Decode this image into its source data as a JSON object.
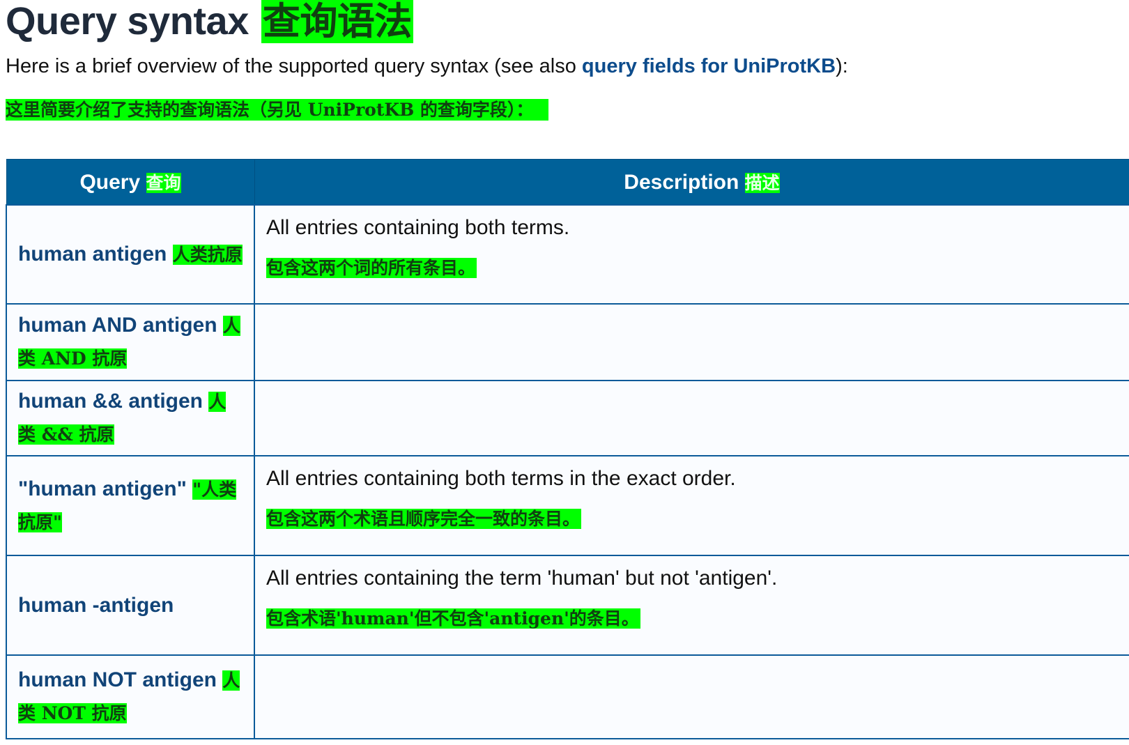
{
  "page": {
    "title_en": "Query syntax",
    "title_zh": "查询语法",
    "intro_before": "Here is a brief overview of the supported query syntax (see also ",
    "intro_link": "query fields for UniProtKB",
    "intro_after": "):",
    "intro_zh": "这里简要介绍了支持的查询语法（另见 UniProtKB 的查询字段）："
  },
  "table": {
    "headers": [
      {
        "en": "Query",
        "zh": "查询"
      },
      {
        "en": "Description",
        "zh": "描述"
      }
    ],
    "rows": [
      {
        "query": "human antigen",
        "query_zh": "人类抗原",
        "desc": "All entries containing both terms.",
        "desc_zh": "包含这两个词的所有条目。"
      },
      {
        "query": "human AND antigen",
        "query_zh": "人类 AND 抗原",
        "desc": "",
        "desc_zh": ""
      },
      {
        "query": "human && antigen",
        "query_zh": "人类 && 抗原",
        "desc": "",
        "desc_zh": ""
      },
      {
        "query": "\"human antigen\"",
        "query_zh": "\"人类抗原\"",
        "desc": "All entries containing both terms in the exact order.",
        "desc_zh": "包含这两个术语且顺序完全一致的条目。"
      },
      {
        "query": "human -antigen",
        "query_zh": "",
        "desc": "All entries containing the term 'human' but not 'antigen'.",
        "desc_zh": "包含术语'human'但不包含'antigen'的条目。"
      },
      {
        "query": "human NOT antigen",
        "query_zh": "人类 NOT 抗原",
        "desc": "",
        "desc_zh": ""
      }
    ]
  },
  "colors": {
    "header_bg": "#006199",
    "highlight": "#00ff00",
    "link": "#0d4c8c"
  }
}
